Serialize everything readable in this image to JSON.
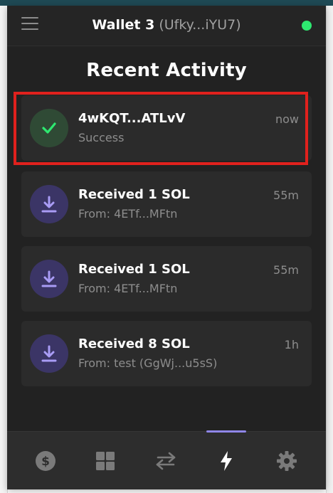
{
  "header": {
    "wallet_name": "Wallet 3",
    "wallet_address": "(Ufky...iYU7)",
    "status_color": "#2ee870"
  },
  "page": {
    "title": "Recent Activity"
  },
  "activity": [
    {
      "title": "4wKQT...ATLvV",
      "subtitle": "Success",
      "time": "now",
      "type": "success",
      "icon": "check-icon"
    },
    {
      "title": "Received 1 SOL",
      "subtitle": "From: 4ETf...MFtn",
      "time": "55m",
      "type": "received",
      "icon": "download-icon"
    },
    {
      "title": "Received 1 SOL",
      "subtitle": "From: 4ETf...MFtn",
      "time": "55m",
      "type": "received",
      "icon": "download-icon"
    },
    {
      "title": "Received 8 SOL",
      "subtitle": "From: test (GgWj...u5sS)",
      "time": "1h",
      "type": "received",
      "icon": "download-icon"
    }
  ],
  "nav": {
    "items": [
      "dollar-icon",
      "grid-icon",
      "swap-icon",
      "lightning-icon",
      "gear-icon"
    ],
    "active": "lightning-icon"
  },
  "colors": {
    "highlight": "#e0211d",
    "accent": "#8f86e8",
    "success_check": "#2ee870"
  }
}
